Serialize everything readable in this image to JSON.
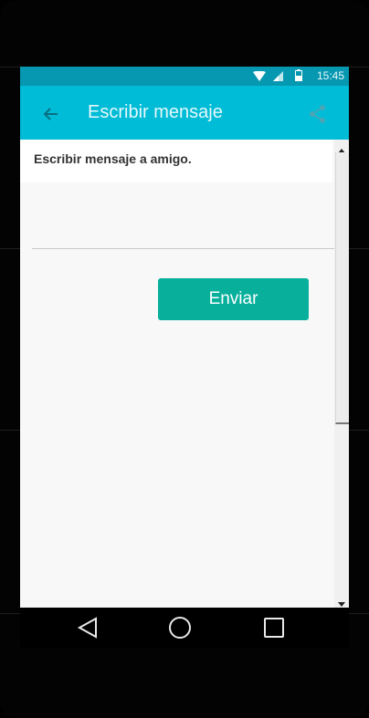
{
  "status_bar": {
    "time": "15:45",
    "icons": [
      "wifi-icon",
      "signal-icon",
      "battery-icon"
    ]
  },
  "app_bar": {
    "title": "Escribir mensaje",
    "back_icon": "arrow-back-icon",
    "share_icon": "share-icon",
    "color": "#00bcd6",
    "status_color": "#0798b1"
  },
  "content": {
    "header_label": "Escribir mensaje a amigo.",
    "message_input": {
      "value": "",
      "placeholder": ""
    },
    "send_button_label": "Enviar",
    "send_button_color": "#08b09c"
  },
  "nav_bar": {
    "icons": [
      "nav-back-icon",
      "nav-home-icon",
      "nav-recents-icon"
    ]
  }
}
